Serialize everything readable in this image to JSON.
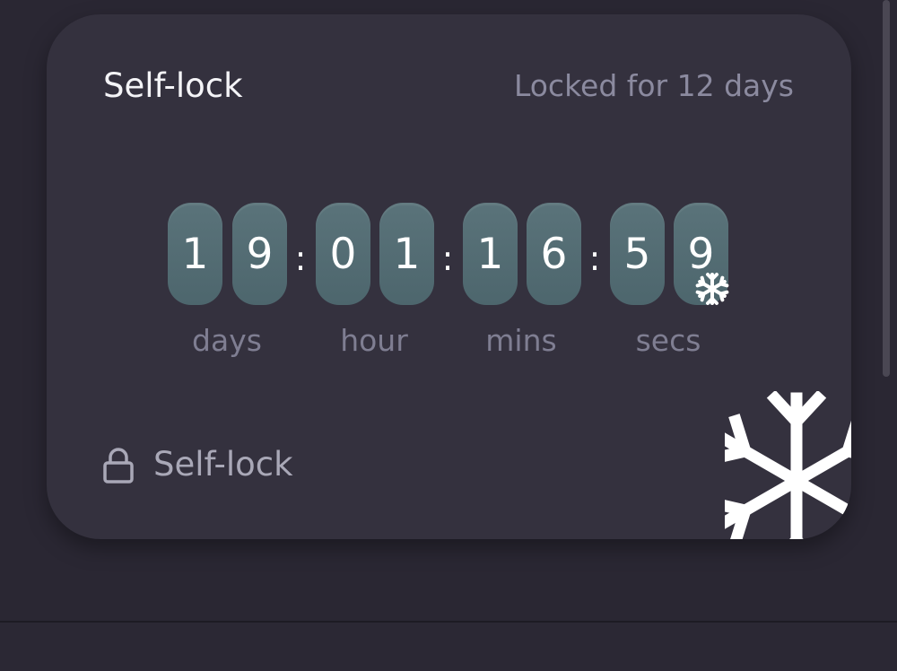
{
  "card": {
    "title": "Self-lock",
    "status": "Locked for 12 days",
    "footer_label": "Self-lock"
  },
  "countdown": {
    "digits": [
      "1",
      "9",
      "0",
      "1",
      "1",
      "6",
      "5",
      "9"
    ],
    "separator": ":",
    "units": [
      "days",
      "hour",
      "mins",
      "secs"
    ]
  },
  "icons": {
    "lock": "lock-icon",
    "snowflake_small": "snowflake-icon",
    "snowflake_large": "snowflake-icon"
  },
  "colors": {
    "background": "#2a2733",
    "card": "#34313e",
    "digit_tile": "#56707a",
    "muted_text": "#8b8a9f"
  }
}
